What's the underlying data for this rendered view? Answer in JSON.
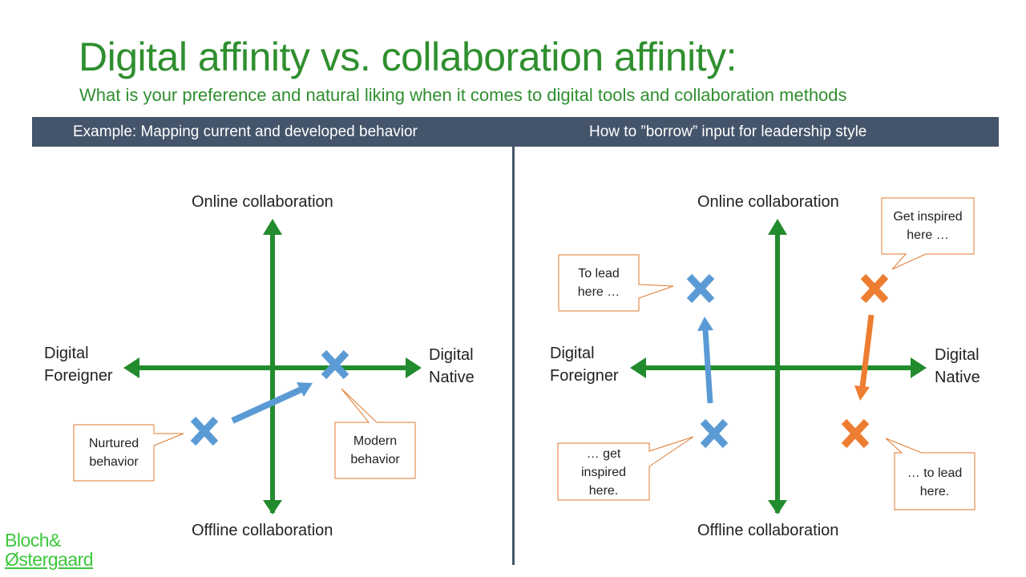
{
  "header": {
    "title": "Digital affinity vs. collaboration affinity:",
    "subtitle": "What is your preference and natural liking when it comes to digital tools and collaboration methods"
  },
  "panels": [
    {
      "heading": "Example: Mapping current and developed behavior",
      "axes": {
        "top": "Online collaboration",
        "bottom": "Offline collaboration",
        "left_line1": "Digital",
        "left_line2": "Foreigner",
        "right_line1": "Digital",
        "right_line2": "Native"
      },
      "callouts": [
        {
          "line1": "Nurtured",
          "line2": "behavior"
        },
        {
          "line1": "Modern",
          "line2": "behavior"
        }
      ]
    },
    {
      "heading": "How to ”borrow” input for leadership style",
      "axes": {
        "top": "Online collaboration",
        "bottom": "Offline collaboration",
        "left_line1": "Digital",
        "left_line2": "Foreigner",
        "right_line1": "Digital",
        "right_line2": "Native"
      },
      "callouts": [
        {
          "line1": "To lead",
          "line2": "here …"
        },
        {
          "line1": "Get inspired",
          "line2": "here …"
        },
        {
          "line1": "… get",
          "line2": "inspired",
          "line3": "here."
        },
        {
          "line1": "… to lead",
          "line2": "here."
        }
      ]
    }
  ],
  "colors": {
    "title_green": "#2f8f2f",
    "axis_green": "#228b2d",
    "band": "#44546a",
    "marker_blue": "#5b9bd5",
    "marker_orange": "#ed7d31",
    "callout_border": "#e07a30",
    "logo_green": "#3cc83c"
  },
  "logo": {
    "line1": "Bloch&",
    "line2": "Østergaard"
  }
}
